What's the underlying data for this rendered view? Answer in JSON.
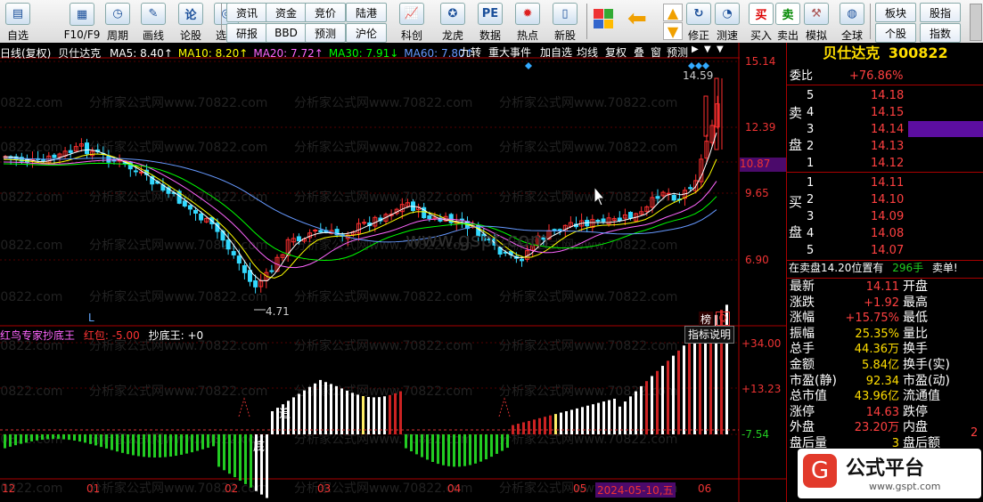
{
  "toolbar": {
    "items": [
      {
        "label": "自选",
        "icon": "star-list-icon"
      },
      {
        "label": "F10/F9",
        "icon": "f10-icon"
      },
      {
        "label": "周期",
        "icon": "clock-icon"
      },
      {
        "label": "画线",
        "icon": "pencil-icon"
      },
      {
        "label": "论股",
        "icon": "discuss-icon"
      },
      {
        "label": "选股",
        "icon": "pick-stock-icon"
      }
    ],
    "small_buttons": [
      "资讯",
      "资金",
      "竞价",
      "陆港",
      "研报",
      "BBD",
      "预测",
      "沪伦"
    ],
    "items2": [
      {
        "label": "科创",
        "icon": "science-icon"
      },
      {
        "label": "龙虎",
        "icon": "dragon-tiger-icon"
      },
      {
        "label": "数据",
        "icon": "pe-icon"
      },
      {
        "label": "热点",
        "icon": "hot-icon"
      },
      {
        "label": "新股",
        "icon": "new-stock-icon"
      }
    ],
    "items3": [
      {
        "label": "修正",
        "icon": "fix-icon"
      },
      {
        "label": "测速",
        "icon": "speed-icon"
      },
      {
        "label": "买入",
        "icon": "buy-icon",
        "glyph": "买"
      },
      {
        "label": "卖出",
        "icon": "sell-icon",
        "glyph": "卖"
      },
      {
        "label": "模拟",
        "icon": "hammer-icon"
      },
      {
        "label": "全球",
        "icon": "globe-icon"
      }
    ],
    "small_buttons2": [
      "板块",
      "股指",
      "个股",
      "指数"
    ]
  },
  "chart": {
    "period": "日线(复权)",
    "stock": "贝仕达克",
    "ma": [
      {
        "label": "MA5: 8.40↑",
        "color": "#ffffff"
      },
      {
        "label": "MA10: 8.20↑",
        "color": "#ffff00"
      },
      {
        "label": "MA20: 7.72↑",
        "color": "#ff66ff"
      },
      {
        "label": "MA30: 7.91↓",
        "color": "#00ff00"
      },
      {
        "label": "MA60: 7.80↑",
        "color": "#6699ff"
      }
    ],
    "right_buttons": [
      "九转",
      "重大事件",
      "加自选",
      "均线",
      "复权",
      "叠",
      "窗",
      "预测"
    ],
    "price_ticks": [
      "15.14",
      "12.39",
      "10.87",
      "9.65",
      "6.90"
    ],
    "current_price_tag": "10.87",
    "high_label": "14.59",
    "low_label": "4.71",
    "marker_L": "L",
    "badge1": "榜",
    "badge2": "Q",
    "indicator": {
      "name": "红鸟专家抄底王",
      "hongbao_label": "红包:",
      "hongbao_value": "-5.00",
      "chaodi_label": "抄底王:",
      "chaodi_value": "+0",
      "button": "指标说明",
      "ticks": [
        "+34.00",
        "+13.23",
        "-7.54"
      ],
      "mark_zhui": "追",
      "mark_di": "底"
    },
    "x_labels": [
      "12",
      "01",
      "02",
      "03",
      "04",
      "05",
      "06"
    ],
    "date_tag": "2024-05-10,五",
    "watermark": "分析家公式网www.70822.com",
    "watermark_center": "www.gspt.com"
  },
  "panel": {
    "title": "贝仕达克",
    "code": "300822",
    "weibi_label": "委比",
    "weibi_value": "+76.86%",
    "sell_label_1": "卖",
    "sell_label_2": "盘",
    "buy_label_1": "买",
    "buy_label_2": "盘",
    "sell": [
      {
        "n": "5",
        "p": "14.18"
      },
      {
        "n": "4",
        "p": "14.15"
      },
      {
        "n": "3",
        "p": "14.14"
      },
      {
        "n": "2",
        "p": "14.13"
      },
      {
        "n": "1",
        "p": "14.12"
      }
    ],
    "buy": [
      {
        "n": "1",
        "p": "14.11"
      },
      {
        "n": "2",
        "p": "14.10"
      },
      {
        "n": "3",
        "p": "14.09"
      },
      {
        "n": "4",
        "p": "14.08"
      },
      {
        "n": "5",
        "p": "14.07"
      }
    ],
    "order_line": "在卖盘14.20位置有",
    "order_qty": "296手",
    "order_tail": "卖单!",
    "quotes": [
      {
        "k": "最新",
        "v": "14.11",
        "k2": "开盘",
        "c": "#ff4040"
      },
      {
        "k": "涨跌",
        "v": "+1.92",
        "k2": "最高",
        "c": "#ff4040"
      },
      {
        "k": "涨幅",
        "v": "+15.75%",
        "k2": "最低",
        "c": "#ff4040"
      },
      {
        "k": "振幅",
        "v": "25.35%",
        "k2": "量比",
        "c": "#ffde00"
      },
      {
        "k": "总手",
        "v": "44.36万",
        "k2": "换手",
        "c": "#ffde00"
      },
      {
        "k": "金额",
        "v": "5.84亿",
        "k2": "换手(实)",
        "c": "#ffde00"
      },
      {
        "k": "市盈(静)",
        "v": "92.34",
        "k2": "市盈(动)",
        "c": "#ffde00"
      },
      {
        "k": "总市值",
        "v": "43.96亿",
        "k2": "流通值",
        "c": "#ffde00"
      },
      {
        "k": "涨停",
        "v": "14.63",
        "k2": "跌停",
        "c": "#ff4040"
      },
      {
        "k": "外盘",
        "v": "23.20万",
        "k2": "内盘",
        "c": "#ff4040"
      },
      {
        "k": "盘后量",
        "v": "3",
        "k2": "盘后额",
        "c": "#ffde00"
      }
    ],
    "extra_2": "2",
    "logo_text": "公式平台",
    "logo_url": "www.gspt.com"
  }
}
